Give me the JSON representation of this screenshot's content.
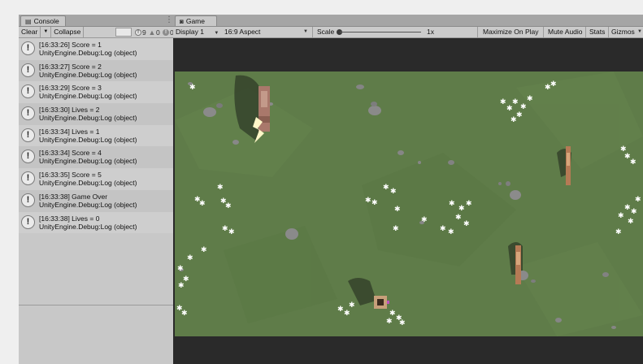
{
  "console": {
    "tab_title": "Console",
    "toolbar": {
      "clear_label": "Clear",
      "collapse_label": "Collapse"
    },
    "counts": {
      "messages": "9",
      "warnings": "0",
      "errors": "0"
    },
    "logs": [
      {
        "message": "[16:33:26] Score = 1",
        "source": "UnityEngine.Debug:Log (object)"
      },
      {
        "message": "[16:33:27] Score = 2",
        "source": "UnityEngine.Debug:Log (object)"
      },
      {
        "message": "[16:33:29] Score = 3",
        "source": "UnityEngine.Debug:Log (object)"
      },
      {
        "message": "[16:33:30] Lives = 2",
        "source": "UnityEngine.Debug:Log (object)"
      },
      {
        "message": "[16:33:34] Lives = 1",
        "source": "UnityEngine.Debug:Log (object)"
      },
      {
        "message": "[16:33:34] Score = 4",
        "source": "UnityEngine.Debug:Log (object)"
      },
      {
        "message": "[16:33:35] Score = 5",
        "source": "UnityEngine.Debug:Log (object)"
      },
      {
        "message": "[16:33:38] Game Over",
        "source": "UnityEngine.Debug:Log (object)"
      },
      {
        "message": "[16:33:38] Lives = 0",
        "source": "UnityEngine.Debug:Log (object)"
      }
    ]
  },
  "game": {
    "tab_title": "Game",
    "toolbar": {
      "display": "Display 1",
      "aspect": "16:9 Aspect",
      "scale_label": "Scale",
      "scale_value": "1x",
      "maximize_on_play": "Maximize On Play",
      "mute_audio": "Mute Audio",
      "stats": "Stats",
      "gizmos": "Gizmos"
    }
  },
  "icons": {
    "console_tab": "console-icon",
    "game_tab": "gamepad-icon",
    "info": "info-icon",
    "warning": "warning-icon",
    "error": "error-icon",
    "log_entry": "exclamation-icon"
  },
  "colors": {
    "grass": "#5e7b48",
    "panel_bg": "#c8c8c8",
    "viewport_frame": "#2a2a2a"
  }
}
